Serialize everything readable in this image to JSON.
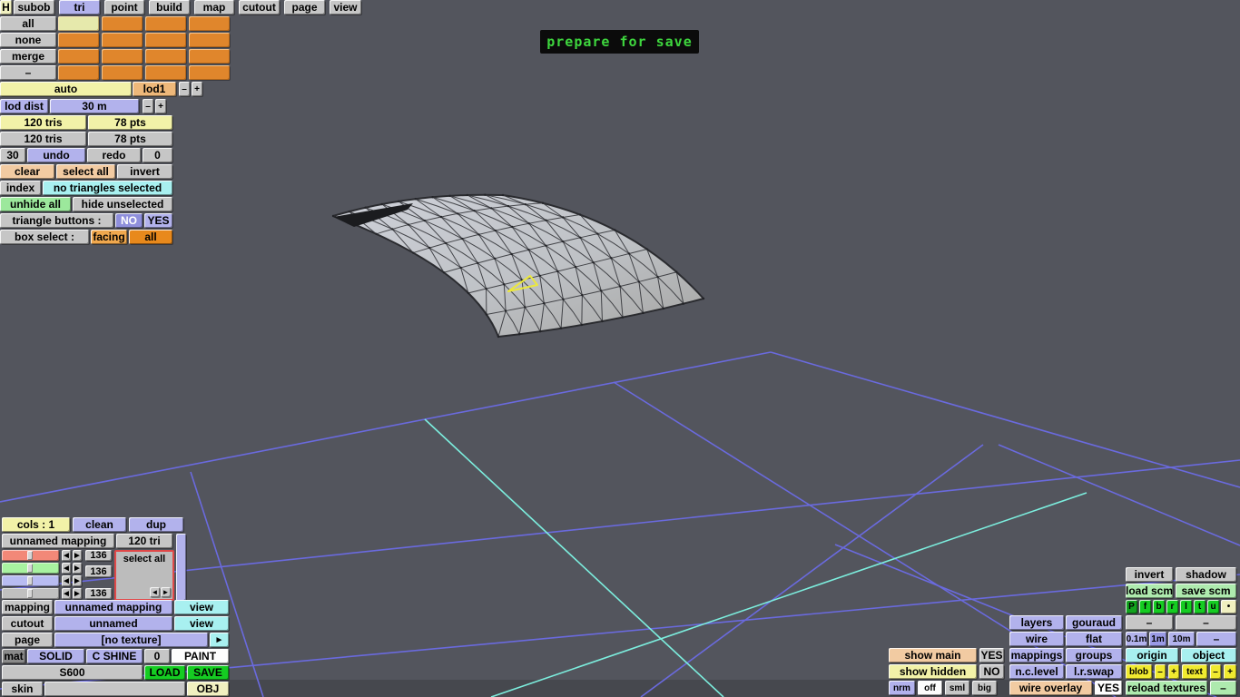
{
  "colors": {
    "viewport_bg": "#53555d",
    "grid_blue": "#6a6ade",
    "grid_cyan": "#7ceede",
    "banner_green": "#3ed63e",
    "selection_yellow": "#ece83c",
    "accent_orange": "#e0862c",
    "accent_lavender": "#b2b2ec"
  },
  "toolbar": {
    "items": [
      "H",
      "subob",
      "tri",
      "point",
      "build",
      "map",
      "cutout",
      "page",
      "view"
    ],
    "active": "tri"
  },
  "subob": {
    "rows": [
      "all",
      "none",
      "merge",
      "–"
    ]
  },
  "lod": {
    "auto": "auto",
    "lod1": "lod1",
    "minus": "–",
    "plus": "+",
    "dist_label": "lod dist",
    "dist_value": "30 m"
  },
  "stats": {
    "tris1": "120 tris",
    "pts1": "78 pts",
    "tris2": "120 tris",
    "pts2": "78 pts"
  },
  "hist": {
    "undo_count": "30",
    "undo": "undo",
    "redo": "redo",
    "redo_count": "0"
  },
  "sel": {
    "clear": "clear",
    "select_all": "select all",
    "invert": "invert",
    "index": "index",
    "status": "no triangles selected",
    "unhide": "unhide all",
    "hide_unsel": "hide unselected",
    "tb_label": "triangle buttons :",
    "no": "NO",
    "yes": "YES",
    "bs_label": "box select :",
    "facing": "facing",
    "all": "all"
  },
  "banner": {
    "text": "prepare for save"
  },
  "map_panel": {
    "cols": "cols : 1",
    "clean": "clean",
    "dup": "dup",
    "name": "unnamed mapping",
    "tris": "120 tri",
    "v1": "136",
    "v2": "136",
    "v3": "136",
    "select_all": "select all",
    "left": "◄",
    "right": "►"
  },
  "obj_panel": {
    "mapping": "mapping",
    "mapping_val": "unnamed mapping",
    "view1": "view",
    "cutout": "cutout",
    "cutout_val": "unnamed",
    "view2": "view",
    "page": "page",
    "page_val": "[no texture]",
    "page_btn": "►",
    "mat": "mat",
    "solid": "SOLID",
    "cshine": "C SHINE",
    "zero": "0",
    "paint": "PAINT",
    "name": "S600",
    "load": "LOAD",
    "save": "SAVE",
    "skin": "skin",
    "obj": "OBJ"
  },
  "view_panel": {
    "invert": "invert",
    "shadow": "shadow",
    "load_scm": "load scm",
    "save_scm": "save scm",
    "letters": [
      "P",
      "f",
      "b",
      "r",
      "l",
      "t",
      "u",
      "•"
    ],
    "layers": "layers",
    "gouraud": "gouraud",
    "dash1": "–",
    "dash2": "–",
    "wire": "wire",
    "flat": "flat",
    "m01": "0.1m",
    "m1": "1m",
    "m10": "10m",
    "dash3": "–",
    "show_main": "show main",
    "yes1": "YES",
    "mappings": "mappings",
    "groups": "groups",
    "origin": "origin",
    "object": "object",
    "show_hidden": "show hidden",
    "no1": "NO",
    "nclevel": "n.c.level",
    "lrswap": "l.r.swap",
    "blob": "blob",
    "blob_minus": "–",
    "blob_plus": "+",
    "text": "text",
    "text_minus": "–",
    "text_plus": "+",
    "nrm": "nrm",
    "off": "off",
    "sml": "sml",
    "big": "big",
    "wire_overlay": "wire overlay",
    "yes2": "YES",
    "reload": "reload textures",
    "dash4": "–"
  }
}
